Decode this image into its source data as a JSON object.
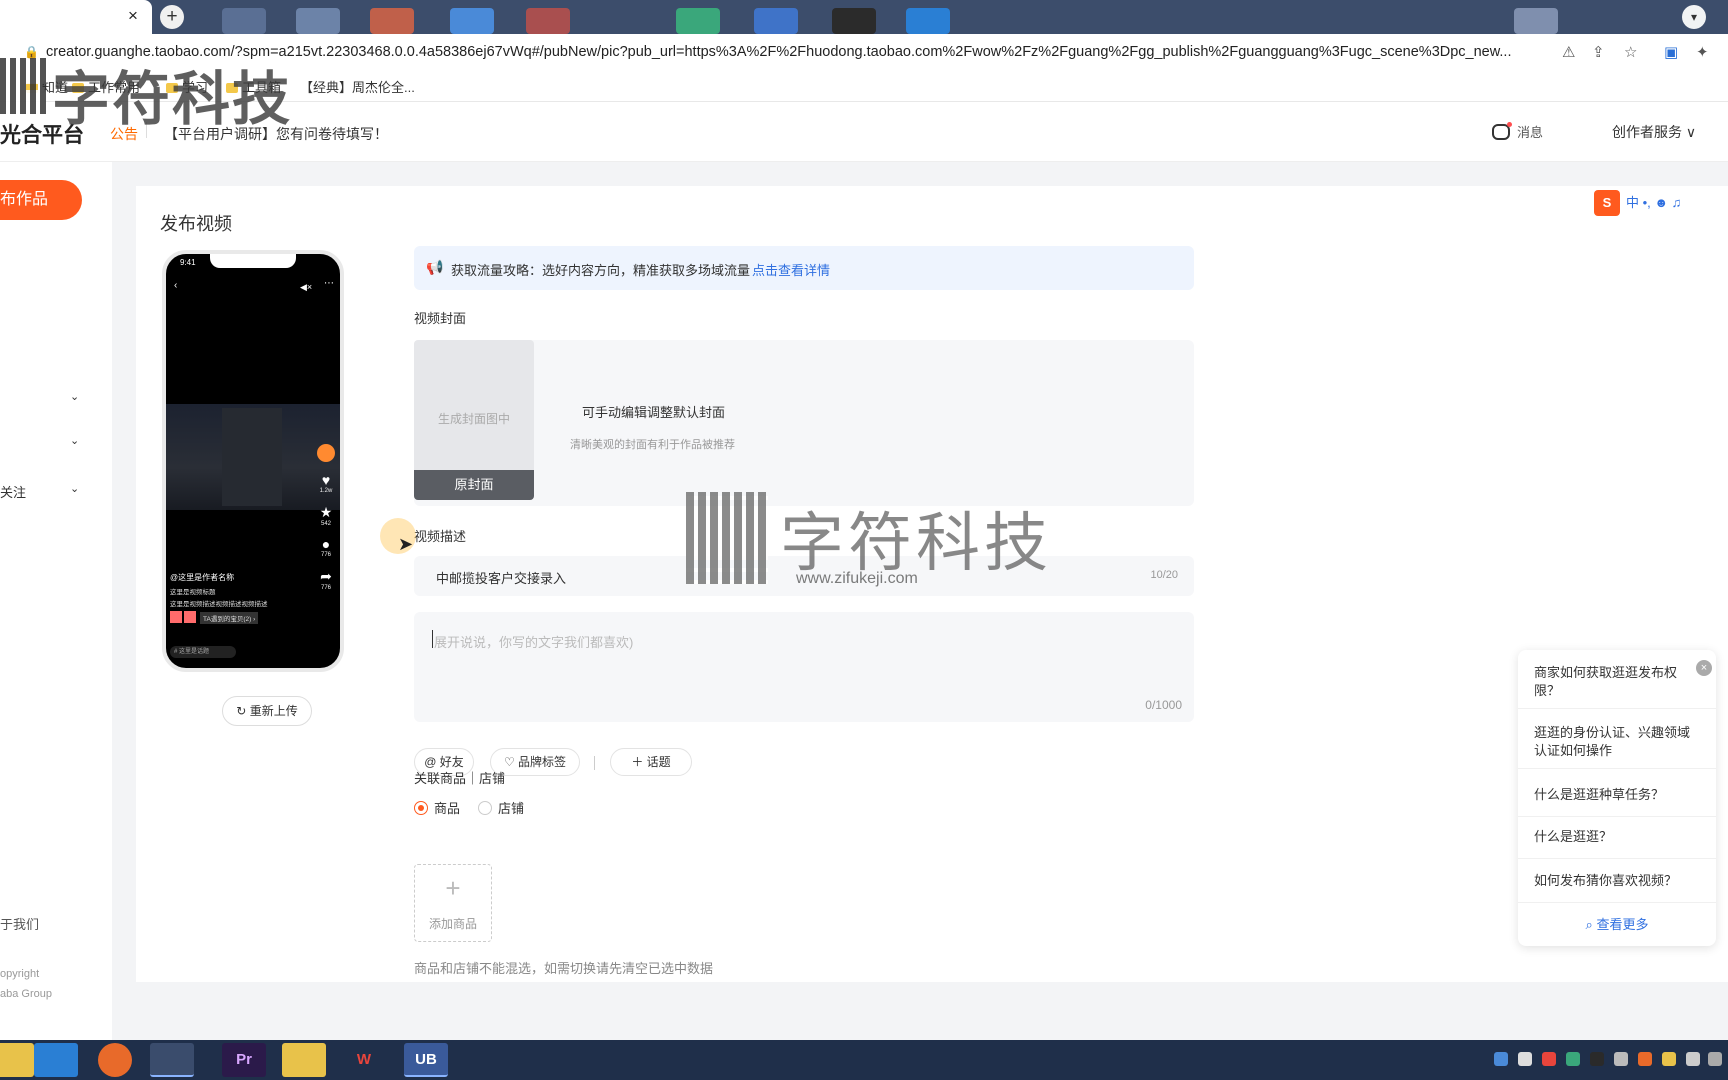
{
  "browser": {
    "url": "creator.guanghe.taobao.com/?spm=a215vt.22303468.0.0.4a58386ej67vWq#/pubNew/pic?pub_url=https%3A%2F%2Fhuodong.taobao.com%2Fwow%2Fz%2Fguang%2Fgg_publish%2Fguangguang%3Fugc_scene%3Dpc_new...",
    "tab_close": "×",
    "new_tab": "+",
    "bookmarks": [
      "知道",
      "工作常用",
      "学习",
      "工具箱",
      "【经典】周杰伦全..."
    ]
  },
  "header": {
    "logo": "光合平台",
    "notice_label": "公告",
    "notice_text": "【平台用户调研】您有问卷待填写！",
    "messages": "消息",
    "creator_service": "创作者服务 ∨"
  },
  "sidebar": {
    "publish": "布作品",
    "rows": [
      "",
      "",
      "关注"
    ],
    "about": "于我们",
    "copyright_1": "opyright",
    "copyright_2": "aba Group"
  },
  "page": {
    "title": "发布视频",
    "phone": {
      "time": "9:41",
      "author": "@这里是作者名称",
      "line1": "这里是视频标题",
      "line2": "这里是视频描述视频描述视频描述",
      "tag": "TA遇到的宝贝(2) ›",
      "bottom": "# 这里是话题",
      "counts": [
        "1.2w",
        "542",
        "776",
        "776"
      ]
    },
    "reupload": "重新上传",
    "tip": {
      "text": "获取流量攻略：选好内容方向，精准获取多场域流量",
      "link": "点击查看详情"
    },
    "cover": {
      "label": "视频封面",
      "generating": "生成封面图中",
      "original": "原封面",
      "hint1": "可手动编辑调整默认封面",
      "hint2": "清晰美观的封面有利于作品被推荐"
    },
    "description": {
      "label": "视频描述",
      "title_value": "中邮揽投客户交接录入",
      "title_count": "10/20",
      "placeholder": "展开说说，你写的文字我们都喜欢)",
      "desc_count": "0/1000"
    },
    "pills": {
      "friend": "@ 好友",
      "brand": "♡ 品牌标签",
      "topic": "＋  话题"
    },
    "association": {
      "label": "关联商品｜店铺",
      "option_goods": "商品",
      "option_shop": "店铺",
      "selected": "商品",
      "add_product": "添加商品",
      "note": "商品和店铺不能混选，如需切换请先清空已选中数据"
    }
  },
  "faq": {
    "items": [
      "商家如何获取逛逛发布权限？",
      "逛逛的身份认证、兴趣领域认证如何操作",
      "什么是逛逛种草任务？",
      "什么是逛逛？",
      "如何发布猜你喜欢视频？"
    ],
    "more": "查看更多"
  },
  "ime": {
    "label": "S",
    "mode": "中 •, ☻ ♫"
  },
  "watermark": {
    "text": "字符科技",
    "url": "www.zifukeji.com"
  },
  "taskbar": {
    "apps": [
      "",
      "",
      "",
      "",
      "Pr",
      "",
      "W",
      "UB"
    ]
  },
  "colors": {
    "accent": "#ff5a1e",
    "link": "#2f6fe0",
    "taskbar": "#1f2f4a"
  }
}
